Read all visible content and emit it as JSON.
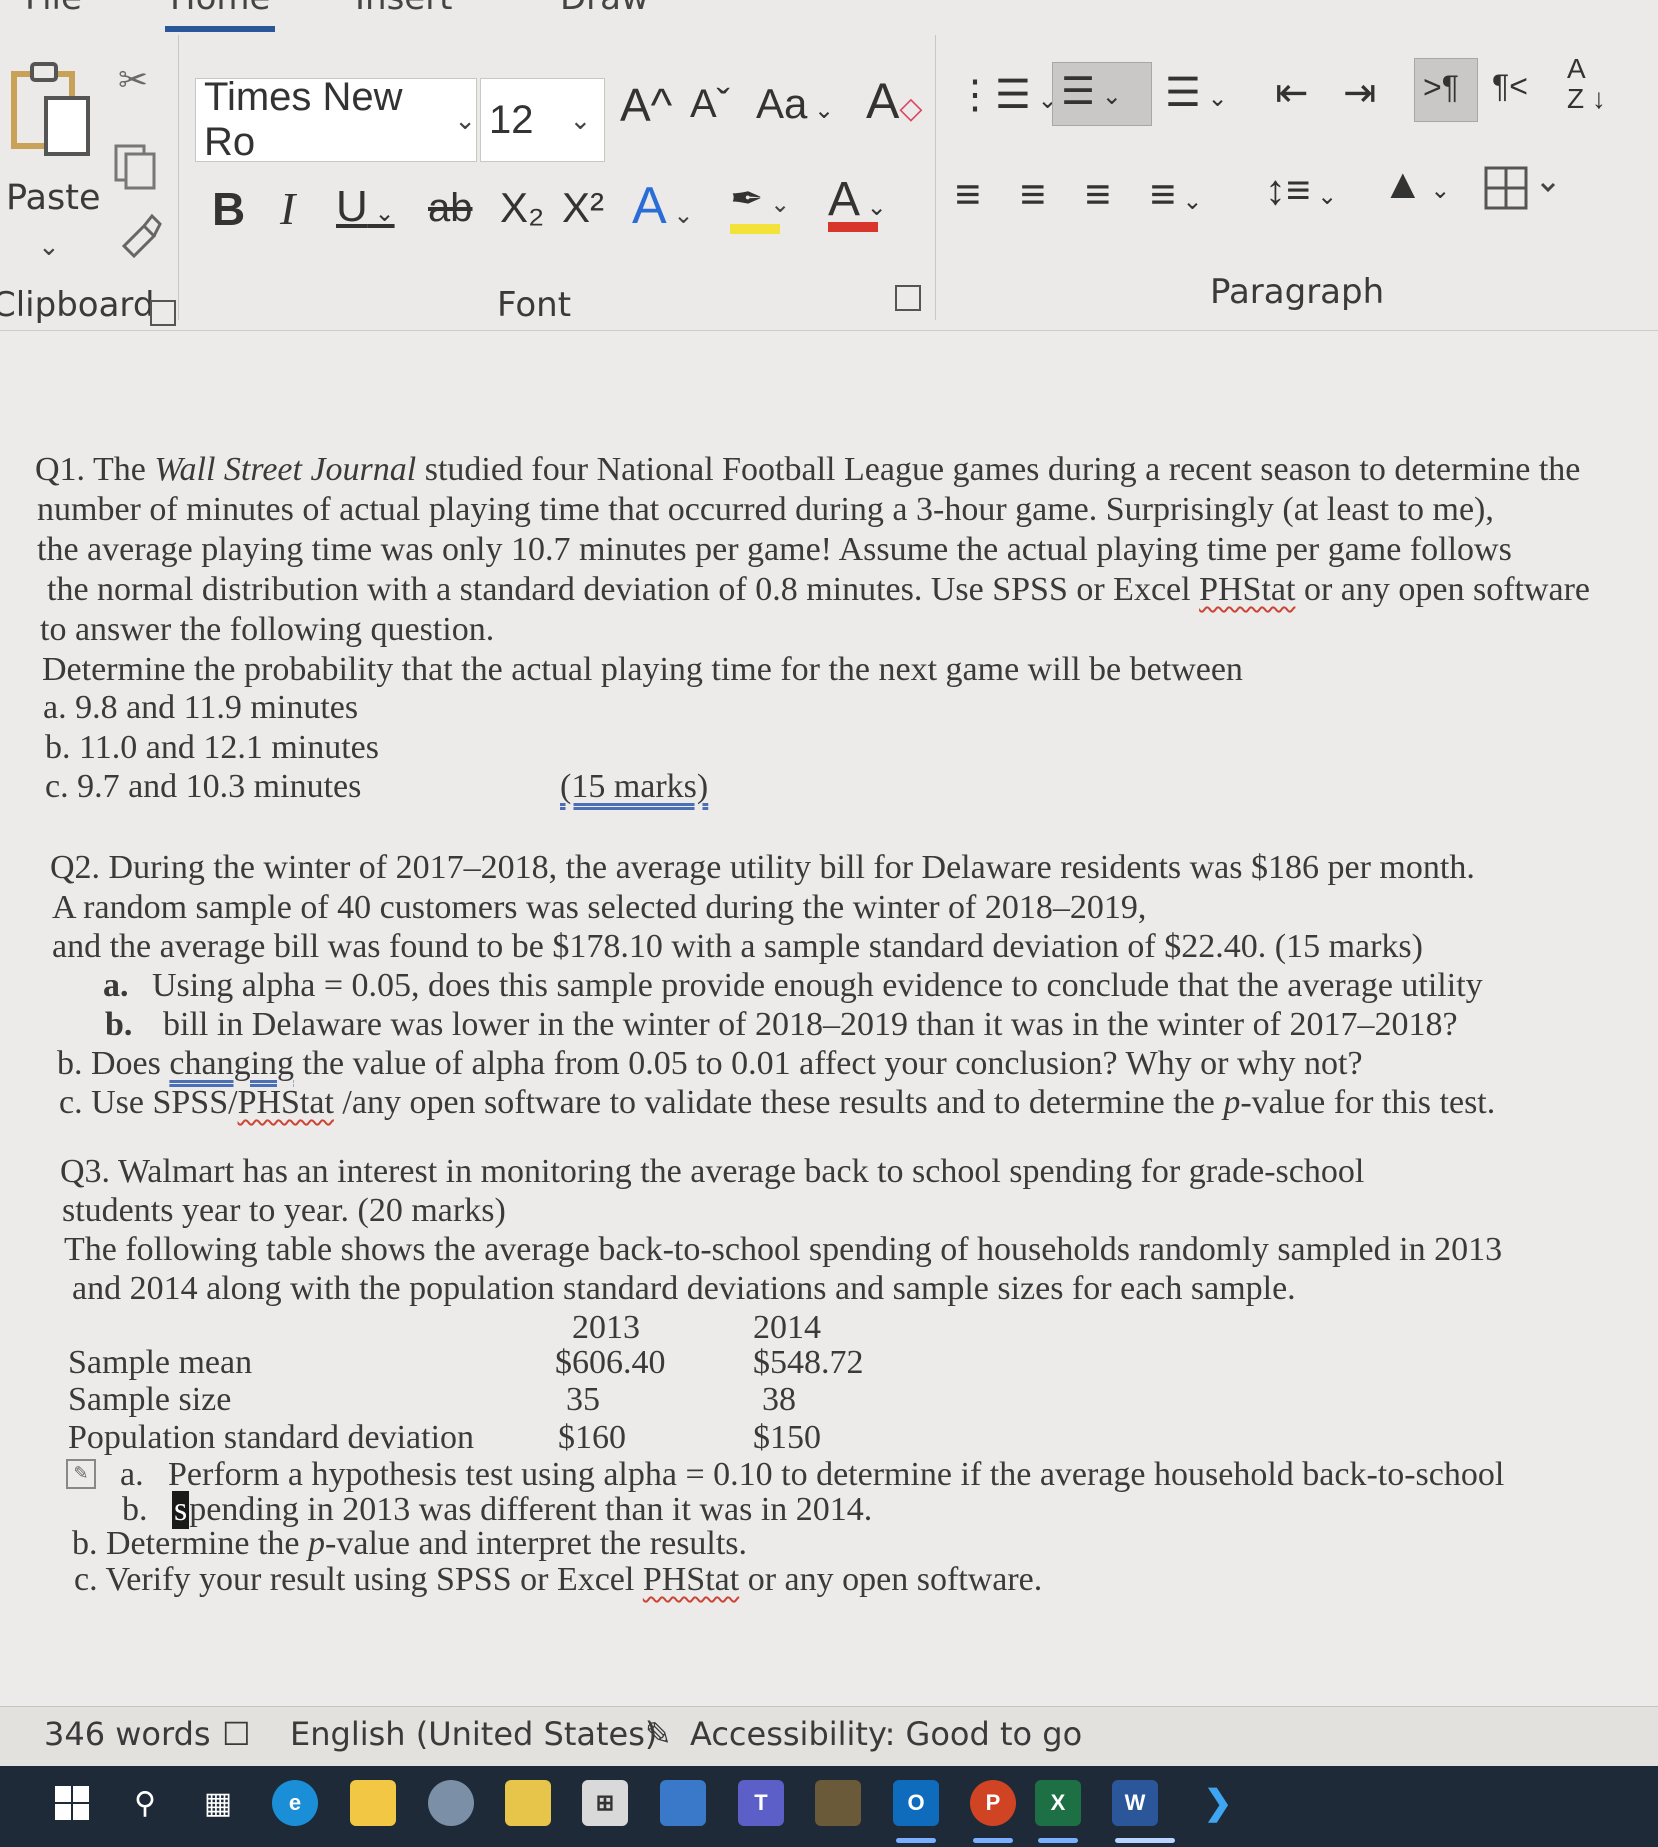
{
  "ribbon": {
    "tabs": [
      "File",
      "Home",
      "Insert",
      "Draw"
    ],
    "clipboard": {
      "paste_label": "Paste",
      "group_label": "Clipboard"
    },
    "font": {
      "font_name": "Times New Ro",
      "font_size": "12",
      "grow_font": "A^",
      "shrink_font": "Aˇ",
      "change_case": "Aa",
      "bold": "B",
      "italic": "I",
      "underline": "U",
      "strikethrough": "ab",
      "subscript": "X₂",
      "superscript": "X²",
      "text_effects": "A",
      "font_color": "A",
      "group_label": "Font"
    },
    "paragraph": {
      "group_label": "Paragraph",
      "show_marks": "¶",
      "ltr": ">¶",
      "rtl": "¶<",
      "sort": "A Z"
    },
    "colors": {
      "highlight": "#f3e23a",
      "font_color": "#d9362b",
      "text_effect": "#2b6dd6",
      "accent": "#2b579a"
    }
  },
  "document": {
    "q1": {
      "line1_pre": "Q1. The ",
      "line1_italic": "Wall Street Journal",
      "line1_post": " studied four National Football League games during a recent season to determine the",
      "line2": "number of minutes of actual playing time that occurred during a 3-hour game. Surprisingly (at least to me),",
      "line3": "the average playing time was only 10.7 minutes per game! Assume the actual playing time per game follows",
      "line4_pre": "the normal distribution with a standard deviation of 0.8 minutes. Use SPSS or Excel ",
      "line4_link": "PHStat",
      "line4_post": " or any open software",
      "line5": "to answer the following question.",
      "line6": "Determine the probability that the actual playing time for the next game will be between",
      "a": "a. 9.8 and 11.9 minutes",
      "b": "b. 11.0 and 12.1 minutes",
      "c": "c. 9.7 and 10.3 minutes",
      "marks": "(15 marks)"
    },
    "q2": {
      "line1": "Q2. During the winter of 2017–2018, the average utility bill for Delaware residents was $186 per month.",
      "line2": "A random sample of 40 customers was selected during the winter of 2018–2019,",
      "line3": "and the average bill was found to be $178.10 with a sample standard deviation of $22.40. (15 marks)",
      "a_label": "a.",
      "a_text": "Using alpha = 0.05, does this sample provide enough evidence to conclude that the average utility",
      "b_label": "b.",
      "b_text": "bill in Delaware was lower in the winter of 2018–2019 than it was in the winter of 2017–2018?",
      "b2_pre": "b. Does ",
      "b2_link": "changing",
      "b2_post": " the value of alpha from 0.05 to 0.01 affect your conclusion? Why or why not?",
      "c_pre": "c. Use SPSS/",
      "c_link": "PHStat",
      "c_mid": " /any open software to validate these results and to determine the ",
      "c_italic": "p",
      "c_post": "-value for this test."
    },
    "q3": {
      "line1": "Q3. Walmart has an interest in monitoring the average back to school spending for grade-school",
      "line2": "students year to year. (20 marks)",
      "line3": "The following table shows the average back-to-school spending of households randomly sampled in 2013",
      "line4": "and 2014 along with the population standard deviations and sample sizes for each sample.",
      "table": {
        "headers": [
          "2013",
          "2014"
        ],
        "rows": [
          {
            "label": "Sample mean",
            "v2013": "$606.40",
            "v2014": "$548.72"
          },
          {
            "label": "Sample size",
            "v2013": "35",
            "v2014": "38"
          },
          {
            "label": "Population standard deviation",
            "v2013": "$160",
            "v2014": "$150"
          }
        ]
      },
      "a_label": "a.",
      "a_text": "Perform a hypothesis test using alpha = 0.10 to determine if the average household back-to-school",
      "b_label": "b.",
      "b_cursor": "s",
      "b_text": "pending in 2013 was different than it was in 2014.",
      "b2_pre": "b. Determine the ",
      "b2_italic": "p",
      "b2_post": "-value and interpret the results.",
      "c_pre": "c. Verify your result using SPSS or Excel ",
      "c_link": "PHStat",
      "c_post": " or any open software."
    }
  },
  "status": {
    "words": "346 words",
    "language": "English (United States)",
    "accessibility": "Accessibility: Good to go"
  },
  "taskbar": {
    "apps": [
      "start",
      "search",
      "task-view",
      "edge",
      "file-explorer",
      "paint",
      "sticky",
      "calculator",
      "store",
      "teams",
      "chart",
      "outlook",
      "powerpoint",
      "excel",
      "word",
      "vscode"
    ]
  }
}
